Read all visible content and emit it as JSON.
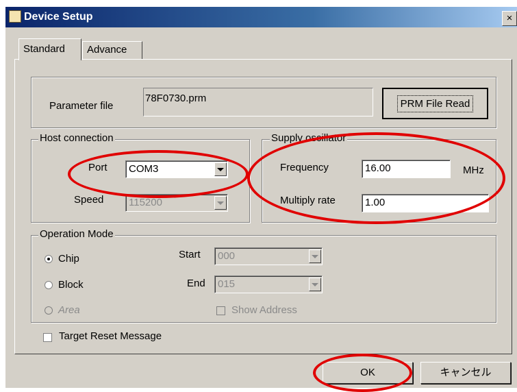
{
  "window": {
    "title": "Device Setup",
    "close_label": "×"
  },
  "tabs": [
    {
      "label": "Standard"
    },
    {
      "label": "Advance"
    }
  ],
  "parameter": {
    "label": "Parameter file",
    "value": "78F0730.prm",
    "read_button": "PRM File Read"
  },
  "host_connection": {
    "title": "Host connection",
    "port": {
      "label": "Port",
      "value": "COM3"
    },
    "speed": {
      "label": "Speed",
      "value": "115200"
    }
  },
  "supply_oscillator": {
    "title": "Supply oscillator",
    "frequency": {
      "label": "Frequency",
      "value": "16.00",
      "unit": "MHz"
    },
    "multiply": {
      "label": "Multiply rate",
      "value": "1.00"
    }
  },
  "operation_mode": {
    "title": "Operation Mode",
    "options": [
      {
        "label": "Chip",
        "selected": true
      },
      {
        "label": "Block",
        "selected": false
      },
      {
        "label": "Area",
        "selected": false,
        "disabled": true
      }
    ],
    "start": {
      "label": "Start",
      "value": "000"
    },
    "end": {
      "label": "End",
      "value": "015"
    },
    "show_address": "Show Address"
  },
  "target_reset_message": "Target Reset Message",
  "buttons": {
    "ok": "OK",
    "cancel": "キャンセル"
  },
  "colors": {
    "annotation": "#e00000",
    "titlebar": "#0a246a",
    "face": "#d4d0c8"
  }
}
